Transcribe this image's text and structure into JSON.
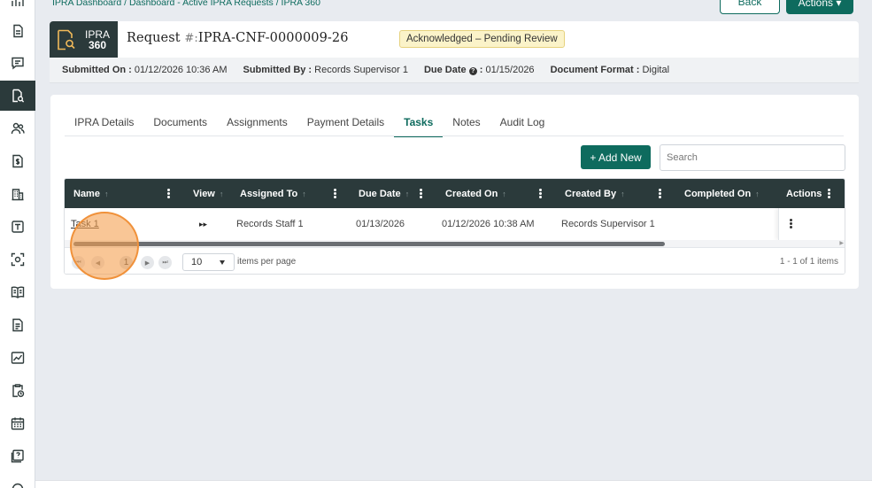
{
  "breadcrumb": "IPRA Dashboard / Dashboard - Active IPRA Requests / IPRA 360",
  "buttons": {
    "back": "Back",
    "actions": "Actions ▾"
  },
  "logo": {
    "line1": "IPRA",
    "line2": "360"
  },
  "request": {
    "label": "Request",
    "hash": "#:",
    "id": "IPRA-CNF-0000009-26",
    "status": "Acknowledged – Pending Review"
  },
  "meta": {
    "submitted_on_label": "Submitted On :",
    "submitted_on": "01/12/2026 10:36 AM",
    "submitted_by_label": "Submitted By :",
    "submitted_by": "Records Supervisor 1",
    "due_date_label": "Due Date",
    "due_date_sep": ":",
    "due_date": "01/15/2026",
    "format_label": "Document Format :",
    "format": "Digital"
  },
  "tabs": [
    "IPRA Details",
    "Documents",
    "Assignments",
    "Payment Details",
    "Tasks",
    "Notes",
    "Audit Log"
  ],
  "active_tab": "Tasks",
  "toolbar": {
    "add_new": "+ Add New",
    "search_placeholder": "Search"
  },
  "grid": {
    "columns": [
      "Name",
      "View",
      "Assigned To",
      "Due Date",
      "Created On",
      "Created By",
      "Completed On",
      "Actions"
    ],
    "sort_glyph": "↑",
    "rows": [
      {
        "name": "Task 1",
        "view": "▸▸",
        "assigned_to": "Records Staff 1",
        "due_date": "01/13/2026",
        "created_on": "01/12/2026 10:38 AM",
        "created_by": "Records Supervisor 1",
        "completed_on": ""
      }
    ]
  },
  "pager": {
    "first": "⏮",
    "prev": "◀",
    "page": "1",
    "next": "▶",
    "last": "⏭",
    "per_page": "10",
    "per_page_label": "items per page",
    "info": "1 - 1 of 1 items"
  },
  "colors": {
    "brand": "#0e6b5e",
    "header_dark": "#2b3a3b",
    "status_bg": "#fbf3c9",
    "highlight": "#f0913a"
  }
}
